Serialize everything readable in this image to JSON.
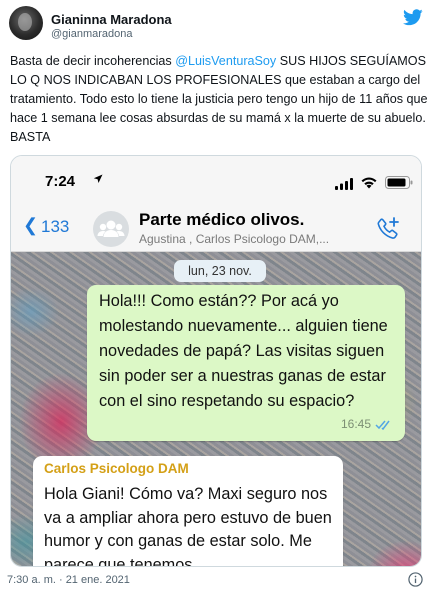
{
  "tweet": {
    "author_name": "Gianinna Maradona",
    "author_handle": "@gianmaradona",
    "text_parts": {
      "before_mention": "Basta de decir incoherencias ",
      "mention": "@LuisVenturaSoy",
      "after_mention": " SUS HIJOS SEGUÍAMOS LO Q NOS INDICABAN LOS PROFESIONALES que estaban a cargo del tratamiento. Todo esto lo tiene la justicia pero tengo un hijo de 11 años que hace 1 semana lee cosas absurdas de su mamá x la muerte de su abuelo. BASTA"
    },
    "timestamp": "7:30 a. m. · 21 ene. 2021",
    "icons": {
      "platform": "twitter-bird-icon",
      "info": "info-icon"
    },
    "colors": {
      "brand": "#1d9bf0",
      "text": "#0f1419",
      "secondary": "#536471"
    }
  },
  "screenshot": {
    "status_bar": {
      "time": "7:24"
    },
    "chat_header": {
      "back_count": "133",
      "group_name": "Parte médico olivos.",
      "members": "Agustina , Carlos Psicologo DAM,..."
    },
    "date_chip": "lun, 23 nov.",
    "outgoing_message": {
      "text": "Hola!!! Como están?? Por acá yo molestando nuevamente... alguien tiene novedades de papá? Las visitas siguen sin poder ser a nuestras ganas de estar con el sino respetando su espacio?",
      "time": "16:45"
    },
    "incoming_message": {
      "sender": "Carlos Psicologo DAM",
      "text": "Hola Giani! Cómo va? Maxi seguro nos va a ampliar ahora pero estuvo de buen humor y con ganas de estar solo. Me parece que tenemos"
    },
    "colors": {
      "outgoing_bubble": "#dcf8c6",
      "sender_name": "#d4a017",
      "ios_blue": "#2079d6"
    }
  }
}
